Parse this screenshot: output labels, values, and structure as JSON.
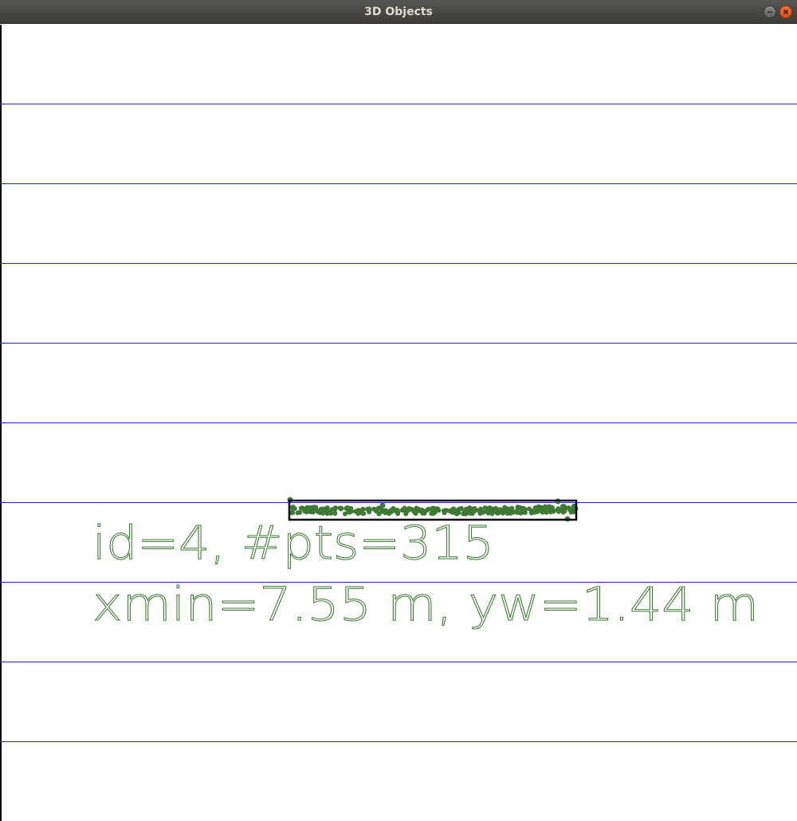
{
  "window": {
    "title": "3D Objects"
  },
  "object": {
    "label_line1": "id=4, #pts=315",
    "label_line2": "xmin=7.55 m, yw=1.44 m"
  },
  "colors": {
    "grid_line": "#2020c0",
    "points": "#3f7a34",
    "label": "#3f7a34",
    "bounding_box": "#000000"
  }
}
